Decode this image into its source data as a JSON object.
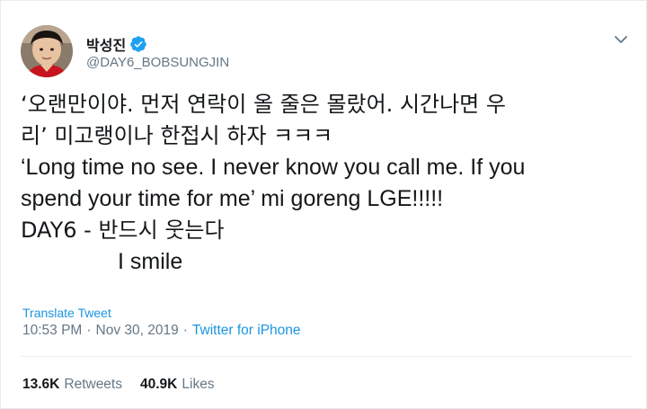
{
  "tweet": {
    "author": {
      "display_name": "박성진",
      "handle": "@DAY6_BOBSUNGJIN"
    },
    "text_lines": [
      "‘오랜만이야. 먼저 연락이 올 줄은 몰랐어. 시간나면 우",
      "리’ 미고랭이나 한접시 하자 ㅋㅋㅋ",
      "‘Long time no see. I never know you call me. If you",
      "spend your time for me’ mi goreng LGE!!!!!",
      "DAY6 - 반드시 웃는다",
      "I smile"
    ],
    "translate_label": "Translate Tweet",
    "time": "10:53 PM",
    "date": "Nov 30, 2019",
    "separator": "·",
    "source": "Twitter for iPhone",
    "retweets_count": "13.6K",
    "retweets_label": "Retweets",
    "likes_count": "40.9K",
    "likes_label": "Likes"
  },
  "colors": {
    "link": "#1b95e0",
    "muted": "#657786",
    "text": "#14171a",
    "verified": "#1da1f2"
  },
  "icons": {
    "verified": "verified-badge-icon",
    "caret": "chevron-down-icon"
  }
}
